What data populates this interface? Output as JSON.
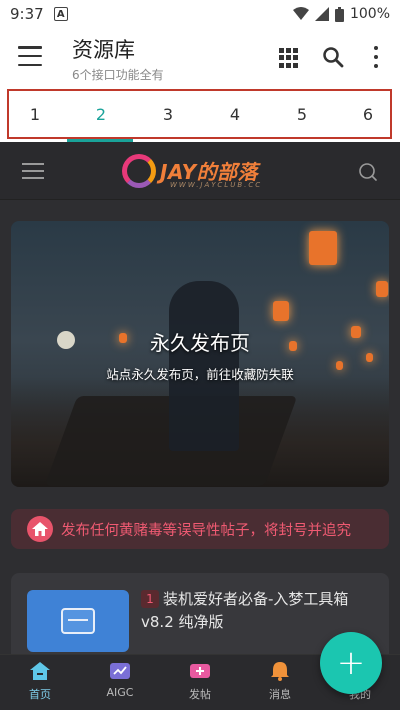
{
  "status_bar": {
    "time": "9:37",
    "notification_icon": "A",
    "battery": "100%"
  },
  "app_bar": {
    "title": "资源库",
    "subtitle": "6个接口功能全有"
  },
  "tabs": [
    {
      "label": "1",
      "active": false
    },
    {
      "label": "2",
      "active": true
    },
    {
      "label": "3",
      "active": false
    },
    {
      "label": "4",
      "active": false
    },
    {
      "label": "5",
      "active": false
    },
    {
      "label": "6",
      "active": false
    }
  ],
  "site": {
    "logo_text": "JAY的部落",
    "logo_sub": "WWW.JAYCLUB.CC",
    "banner": {
      "title": "永久发布页",
      "subtitle": "站点永久发布页，前往收藏防失联"
    },
    "notice": {
      "text": "发布任何黄赌毒等误导性帖子，将封号并追究"
    },
    "card": {
      "badge": "1",
      "title": "装机爱好者必备-入梦工具箱v8.2 纯净版"
    }
  },
  "bottom_nav": [
    {
      "label": "首页",
      "active": true,
      "icon": "home-icon",
      "color": "#5fc7e8"
    },
    {
      "label": "AIGC",
      "active": false,
      "icon": "chart-icon",
      "color": "#7a6fd6"
    },
    {
      "label": "发帖",
      "active": false,
      "icon": "post-icon",
      "color": "#e85aa0"
    },
    {
      "label": "消息",
      "active": false,
      "icon": "bell-icon",
      "color": "#f0923a"
    },
    {
      "label": "我的",
      "active": false,
      "icon": "profile-icon",
      "color": "#6ab0e8"
    }
  ],
  "colors": {
    "accent": "#1aa39a",
    "fab": "#1bc6b0",
    "notice": "#ef5a72",
    "highlight_frame": "#c0392b"
  }
}
